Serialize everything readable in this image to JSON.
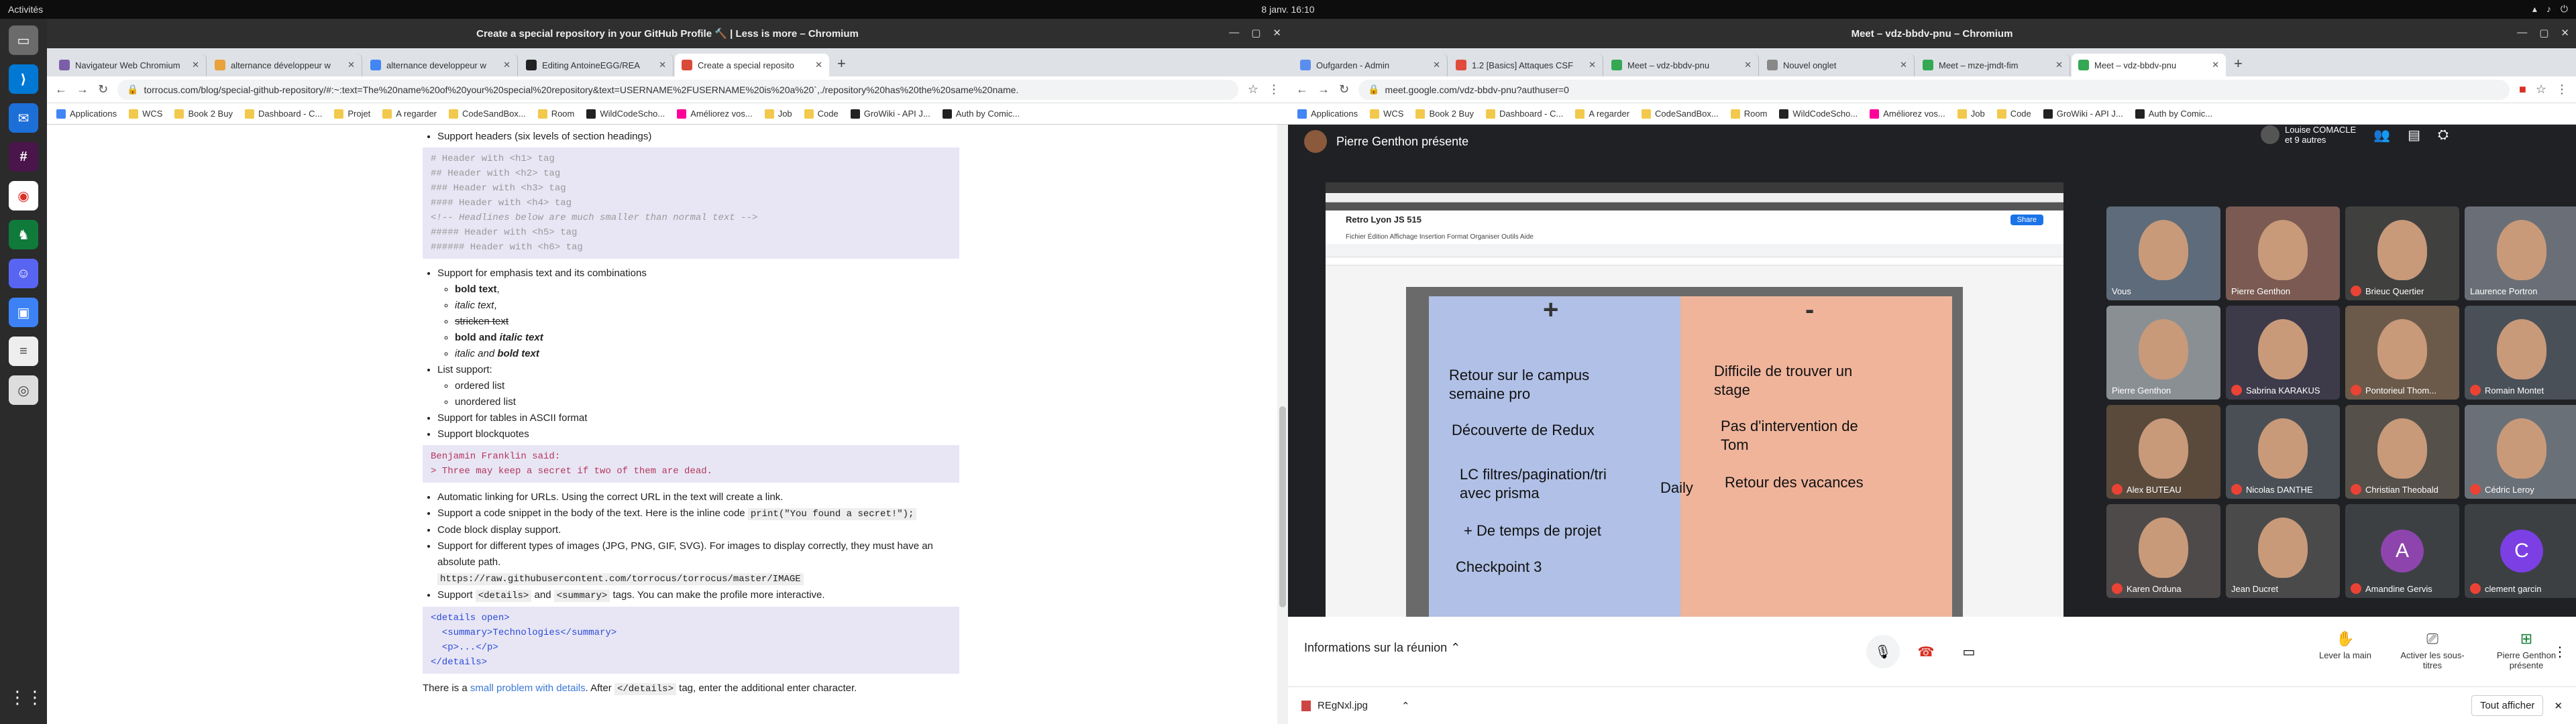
{
  "system": {
    "activities": "Activités",
    "clock": "8 janv.  16:10",
    "dock_items": [
      "files-icon",
      "vscode-icon",
      "thunderbird-icon",
      "slack-icon",
      "chrome-icon",
      "gitkraken-icon",
      "discord-icon",
      "screenshot-icon",
      "text-editor-icon",
      "disk-icon"
    ]
  },
  "left": {
    "title": "Create a special repository in your GitHub Profile 🔨 | Less is more – Chromium",
    "tabs": [
      "Navigateur Web Chromium",
      "alternance développeur w",
      "alternance developpeur w",
      "Editing AntoineEGG/REA",
      "Create a special reposito"
    ],
    "tab_colors": [
      "#7b5ea7",
      "#e8a33d",
      "#4285f4",
      "#222222",
      "#d94a38"
    ],
    "url": "torrocus.com/blog/special-github-repository/#:~:text=The%20name%20of%20your%20special%20repository&text=USERNAME%2FUSERNAME%20is%20a%20`,./repository%20has%20the%20same%20name.",
    "bookmarks": [
      "Applications",
      "WCS",
      "Book 2 Buy",
      "Dashboard - C...",
      "Projet",
      "A regarder",
      "CodeSandBox...",
      "Room",
      "WildCodeScho...",
      "Améliorez vos...",
      "Job",
      "Code",
      "GroWiki - API J...",
      "Auth by Comic..."
    ],
    "doc": {
      "h_intro": "Support headers (six levels of section headings)",
      "headers_code": [
        "# Header with <h1> tag",
        "## Header with <h2> tag",
        "### Header with <h3> tag",
        "#### Header with <h4> tag",
        "<!-- Headlines below are much smaller than normal text -->",
        "##### Header with <h5> tag",
        "###### Header with <h6> tag"
      ],
      "emph_intro": "Support for emphasis text and its combinations",
      "emph": {
        "bold": "bold text",
        "italic": "italic text",
        "strike": "stricken text",
        "bi_pre": "bold and ",
        "bi_em": "italic text",
        "ib_pre": "italic and ",
        "ib_strong": "bold text"
      },
      "list_intro": "List support:",
      "lists": [
        "ordered list",
        "unordered list"
      ],
      "tables": "Support for tables in ASCII format",
      "blockquotes": "Support blockquotes",
      "quote_code": [
        "Benjamin Franklin said:",
        "> Three may keep a secret if two of them are dead."
      ],
      "autolink": "Automatic linking for URLs. Using the correct URL in the text will create a link.",
      "snippet_pre": "Support a code snippet in the body of the text. Here is the inline code",
      "snippet_code": "print(\"You found a secret!\");",
      "codeblock": "Code block display support.",
      "images": "Support for different types of images (JPG, PNG, GIF, SVG). For images to display correctly, they must have an absolute path.",
      "image_url": "https://raw.githubusercontent.com/torrocus/torrocus/master/IMAGE",
      "details_pre": "Support",
      "details_tag1": "<details>",
      "details_and": "and",
      "details_tag2": "<summary>",
      "details_post": "tags. You can make the profile more interactive.",
      "details_code": [
        "<details open>",
        "  <summary>Technologies</summary>",
        "  <p>...</p>",
        "</details>"
      ],
      "problem_pre": "There is a",
      "problem_link": "small problem with details",
      "problem_mid": ". After",
      "problem_tag": "</details>",
      "problem_post": "tag, enter the additional enter character."
    }
  },
  "right": {
    "title": "Meet – vdz-bbdv-pnu – Chromium",
    "tabs": [
      "Oufgarden - Admin",
      "1.2 [Basics] Attaques CSF",
      "Meet – vdz-bbdv-pnu",
      "Nouvel onglet",
      "Meet – mze-jmdt-fim",
      "Meet – vdz-bbdv-pnu"
    ],
    "tab_colors": [
      "#5b8def",
      "#e04b3c",
      "#34a853",
      "#888888",
      "#34a853",
      "#34a853"
    ],
    "url": "meet.google.com/vdz-bbdv-pnu?authuser=0",
    "bookmarks": [
      "Applications",
      "WCS",
      "Book 2 Buy",
      "Dashboard - C...",
      "A regarder",
      "CodeSandBox...",
      "Room",
      "WildCodeScho...",
      "Améliorez vos...",
      "Job",
      "Code",
      "GroWiki - API J...",
      "Auth by Comic..."
    ],
    "presenter": "Pierre Genthon présente",
    "people_badge": {
      "name": "Louise COMACLE",
      "others": "et 9 autres"
    },
    "shared": {
      "doc_title": "Retro Lyon JS 515",
      "menu": "Fichier  Édition  Affichage  Insertion  Format  Organiser  Outils  Aide",
      "share_btn": "Share"
    },
    "board": {
      "plus": "+",
      "minus": "-",
      "left": [
        "Retour sur le campus semaine pro",
        "Découverte de Redux",
        "LC filtres/pagination/tri avec prisma",
        "+     De temps de projet",
        "Checkpoint 3"
      ],
      "center": "Daily",
      "right": [
        "Difficile de trouver un stage",
        "Pas d'intervention de Tom",
        "Retour des vacances"
      ]
    },
    "participants": [
      {
        "name": "Vous",
        "color": "#5d6b7a",
        "muted": false
      },
      {
        "name": "Pierre Genthon",
        "color": "#7a5a52",
        "muted": false
      },
      {
        "name": "Brieuc Quertier",
        "color": "#40403f",
        "muted": true
      },
      {
        "name": "Laurence Portron",
        "color": "#6a6f77",
        "muted": false
      },
      {
        "name": "Pierre Genthon",
        "color": "#8a8f94",
        "muted": false
      },
      {
        "name": "Sabrina KARAKUS",
        "color": "#3d3a4a",
        "muted": true
      },
      {
        "name": "Pontorieul Thom...",
        "color": "#6b5a4a",
        "muted": true
      },
      {
        "name": "Romain Montet",
        "color": "#4a5058",
        "muted": true
      },
      {
        "name": "Alex BUTEAU",
        "color": "#5a4a3c",
        "muted": true
      },
      {
        "name": "Nicolas DANTHE",
        "color": "#4a4f55",
        "muted": true
      },
      {
        "name": "Christian Theobald",
        "color": "#55504a",
        "muted": true
      },
      {
        "name": "Cédric Leroy",
        "color": "#6a7078",
        "muted": true
      },
      {
        "name": "Karen Orduna",
        "color": "#4f4a4a",
        "muted": true
      },
      {
        "name": "Jean Ducret",
        "color": "#4a4a4a",
        "muted": false
      },
      {
        "name": "Amandine Gervis",
        "color": "#3c4043",
        "muted": true,
        "initial": "A",
        "ini_color": "#8e44ad"
      },
      {
        "name": "clement garcin",
        "color": "#3c4043",
        "muted": true,
        "initial": "C",
        "ini_color": "#7b3fe4"
      }
    ],
    "controls": {
      "info": "Informations sur la réunion",
      "raise": "Lever la main",
      "captions": "Activer les sous-titres",
      "present": "Pierre Genthon présente"
    },
    "download": {
      "file": "REgNxl.jpg",
      "show_all": "Tout afficher"
    }
  }
}
